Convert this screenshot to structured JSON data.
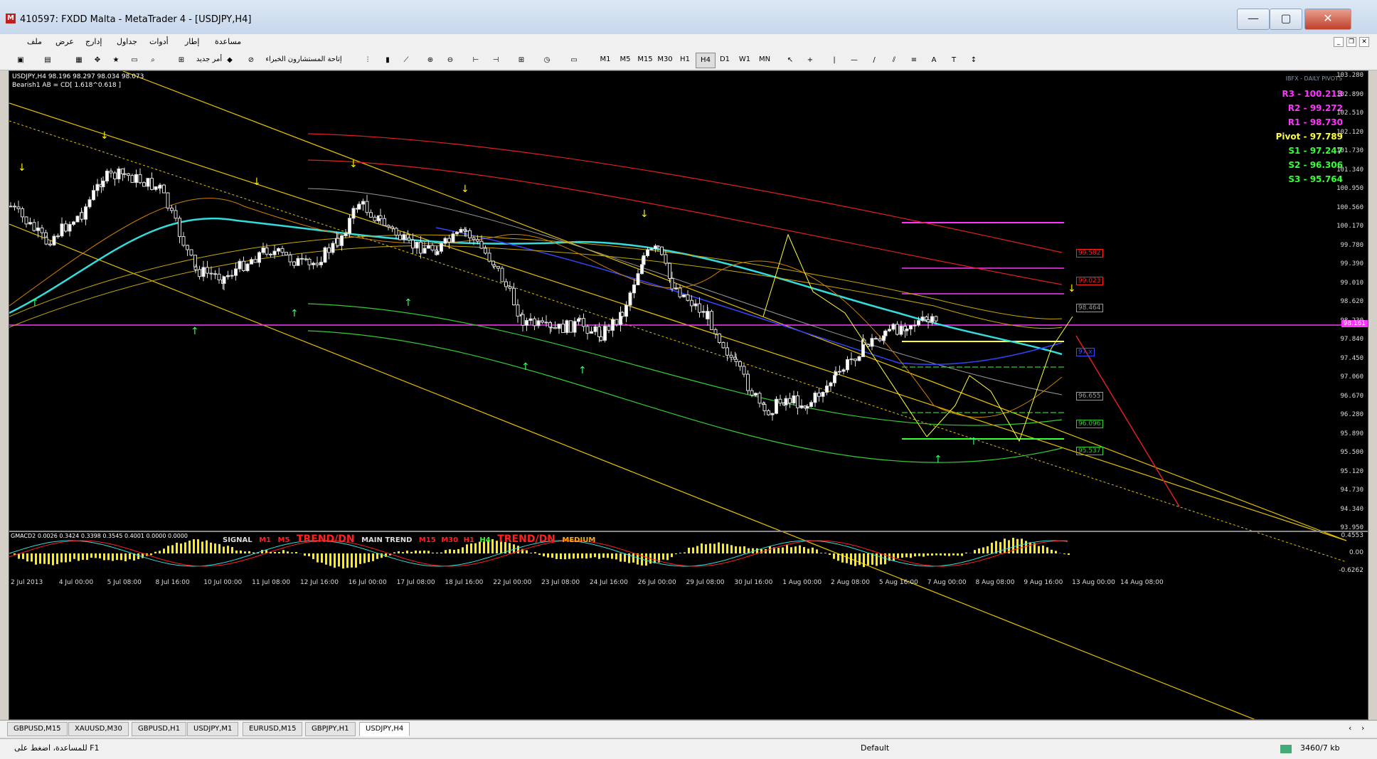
{
  "window": {
    "title": "410597: FXDD Malta - MetaTrader 4 - [USDJPY,H4]",
    "buttons": {
      "minimize": "—",
      "maximize": "▢",
      "close": "✕"
    }
  },
  "menu": {
    "items": [
      "ملف",
      "عرض",
      "إدارج",
      "جداول",
      "أدوات",
      "إطار",
      "مساعدة"
    ],
    "mdi_buttons": {
      "minimize": "_",
      "restore": "❐",
      "close": "✕"
    }
  },
  "toolbar": {
    "new_order": "أمر جديد",
    "experts": "إتاحة المستشارون الخبراء",
    "timeframes": [
      "M1",
      "M5",
      "M15",
      "M30",
      "H1",
      "H4",
      "D1",
      "W1",
      "MN"
    ],
    "selected_timeframe": "H4",
    "text_tool": "A"
  },
  "chart": {
    "header": "USDJPY,H4  98.196 98.297 98.034 98.073",
    "pattern": "Bearish1 AB = CD[ 1.618^0.618 ]",
    "price_axis": [
      "103.280",
      "102.890",
      "102.510",
      "102.120",
      "101.730",
      "101.340",
      "100.950",
      "100.560",
      "100.170",
      "99.780",
      "99.390",
      "99.010",
      "98.620",
      "98.230",
      "97.840",
      "97.450",
      "97.060",
      "96.670",
      "96.280",
      "95.890",
      "95.500",
      "95.120",
      "94.730",
      "94.340",
      "93.950"
    ],
    "current_price": "98.161",
    "time_axis": [
      "2 Jul 2013",
      "4 Jul 00:00",
      "5 Jul 08:00",
      "8 Jul 16:00",
      "10 Jul 00:00",
      "11 Jul 08:00",
      "12 Jul 16:00",
      "16 Jul 00:00",
      "17 Jul 08:00",
      "18 Jul 16:00",
      "22 Jul 00:00",
      "23 Jul 08:00",
      "24 Jul 16:00",
      "26 Jul 00:00",
      "29 Jul 08:00",
      "30 Jul 16:00",
      "1 Aug 00:00",
      "2 Aug 08:00",
      "5 Aug 16:00",
      "7 Aug 00:00",
      "8 Aug 08:00",
      "9 Aug 16:00",
      "13 Aug 00:00",
      "14 Aug 08:00"
    ],
    "pivot_panel": {
      "logo": "IBFX - DAILY PIVOTS",
      "levels": [
        {
          "label": "R3 - 100.213",
          "color": "#ff33ff"
        },
        {
          "label": "R2 - 99.272",
          "color": "#ff33ff"
        },
        {
          "label": "R1 - 98.730",
          "color": "#ff33ff"
        },
        {
          "label": "Pivot - 97.789",
          "color": "#ffff33"
        },
        {
          "label": "S1 - 97.247",
          "color": "#33ff33"
        },
        {
          "label": "S2 - 96.306",
          "color": "#33ff33"
        },
        {
          "label": "S3 - 95.764",
          "color": "#33ff33"
        }
      ]
    },
    "level_tags": [
      {
        "text": "99.582",
        "color": "#ff2020"
      },
      {
        "text": "99.023",
        "color": "#ff2020"
      },
      {
        "text": "98.464",
        "color": "#999999"
      },
      {
        "text": "97.x",
        "color": "#3050ff"
      },
      {
        "text": "96.655",
        "color": "#999999"
      },
      {
        "text": "96.096",
        "color": "#33cc33"
      },
      {
        "text": "95.537",
        "color": "#33cc33"
      }
    ]
  },
  "subwindow": {
    "header": "GMACD2 0.0026 0.3424 0.3398 0.3545 0.4001 0.0000 0.0000",
    "signal": "SIGNAL",
    "m1": "M1",
    "m5": "M5",
    "trend1": "TREND/DN",
    "main_trend": "MAIN TREND",
    "m15": "M15",
    "m30": "M30",
    "h1": "H1",
    "h4": "H4",
    "trend2": "TREND/DN",
    "medium": "MEDIUM",
    "axis": [
      "0.4553",
      "0.00",
      "-0.6262"
    ]
  },
  "tabs": [
    "GBPUSD,M15",
    "XAUUSD,M30",
    "GBPUSD,H1",
    "USDJPY,M1",
    "EURUSD,M15",
    "GBPJPY,H1",
    "USDJPY,H4"
  ],
  "active_tab": "USDJPY,H4",
  "status": {
    "help": "للمساعدة، اضغط على F1",
    "profile": "Default",
    "traffic": "3460/7 kb"
  }
}
